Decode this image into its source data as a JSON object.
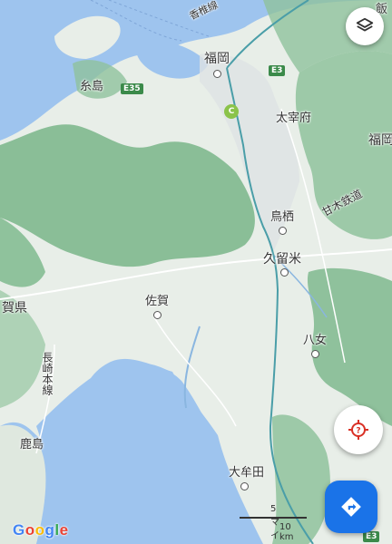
{
  "map": {
    "places": {
      "fukuoka": "福岡",
      "itoshima": "糸島",
      "dazaifu": "太宰府",
      "fukuoka_pref": "福岡",
      "tosu": "鳥栖",
      "amagi_railway": "甘木鉄道",
      "kurume": "久留米",
      "saga": "佐賀",
      "saga_pref": "賀県",
      "yame": "八女",
      "nagasaki_line": "長崎本線",
      "kashima": "鹿島",
      "omuta": "大牟田",
      "kashii_line": "香椎線",
      "top_right": "飯"
    },
    "shields": {
      "e3_north": "E3",
      "e35": "E35",
      "c_route": "C",
      "e3_south": "E3"
    },
    "scale": {
      "miles_label": "5 マイル",
      "km_label": "10 km"
    },
    "logo": "Google"
  },
  "controls": {
    "layers_icon": "layers-icon",
    "locate_icon": "gps-target-icon",
    "directions_icon": "directions-arrow-icon"
  },
  "colors": {
    "sea": "#9ec4ee",
    "land": "#e8eee8",
    "forest": "#7fb88e",
    "highway": "#4a9ea8",
    "directions": "#1a73e8",
    "locate_red": "#d93025"
  }
}
